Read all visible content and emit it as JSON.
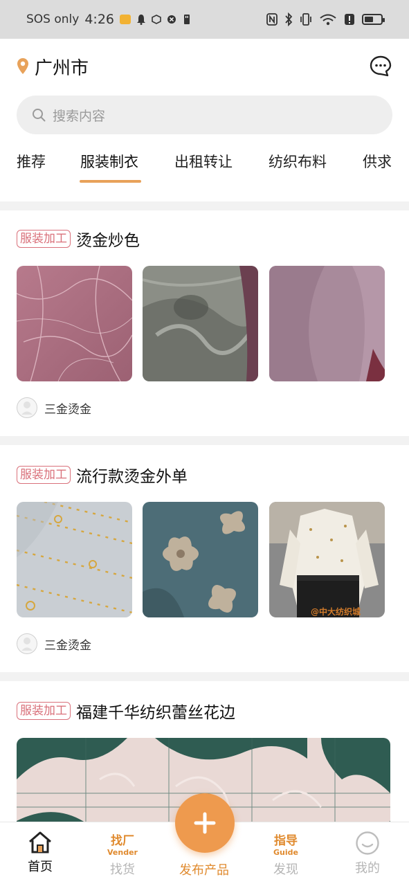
{
  "status_bar": {
    "carrier": "SOS only",
    "time": "4:26",
    "battery_level": 0.55
  },
  "header": {
    "city": "广州市",
    "location_icon": "location-pin-icon",
    "message_icon": "chat-bubble-icon"
  },
  "search": {
    "placeholder": "搜索内容"
  },
  "tabs": [
    {
      "label": "推荐",
      "active": false
    },
    {
      "label": "服装制衣",
      "active": true
    },
    {
      "label": "出租转让",
      "active": false
    },
    {
      "label": "纺织布料",
      "active": false
    },
    {
      "label": "供求",
      "active": false
    }
  ],
  "posts": [
    {
      "tag": "服装加工",
      "title": "烫金炒色",
      "author": "三金烫金",
      "images": [
        "pink-marble-fabric",
        "grey-tie-dye-fabric",
        "lilac-twill-fabric"
      ]
    },
    {
      "tag": "服装加工",
      "title": "流行款烫金外单",
      "author": "三金烫金",
      "images": [
        "gold-dot-sheer-fabric",
        "floral-print-fabric",
        "white-blouse-model"
      ],
      "watermark": "@中大纺织城"
    },
    {
      "tag": "服装加工",
      "title": "福建千华纺织蕾丝花边",
      "images": [
        "green-lace-fabric"
      ]
    }
  ],
  "bottom_nav": {
    "home": {
      "label": "首页"
    },
    "find_factory": {
      "icon_text": "找厂",
      "icon_sub": "Vender",
      "label": "找货"
    },
    "publish": {
      "label": "发布产品"
    },
    "guide": {
      "icon_text": "指导",
      "icon_sub": "Guide",
      "label": "发现"
    },
    "mine": {
      "label": "我的"
    }
  },
  "colors": {
    "accent": "#e8a25a",
    "tag": "#d9707a",
    "fab": "#ee9a4e"
  }
}
